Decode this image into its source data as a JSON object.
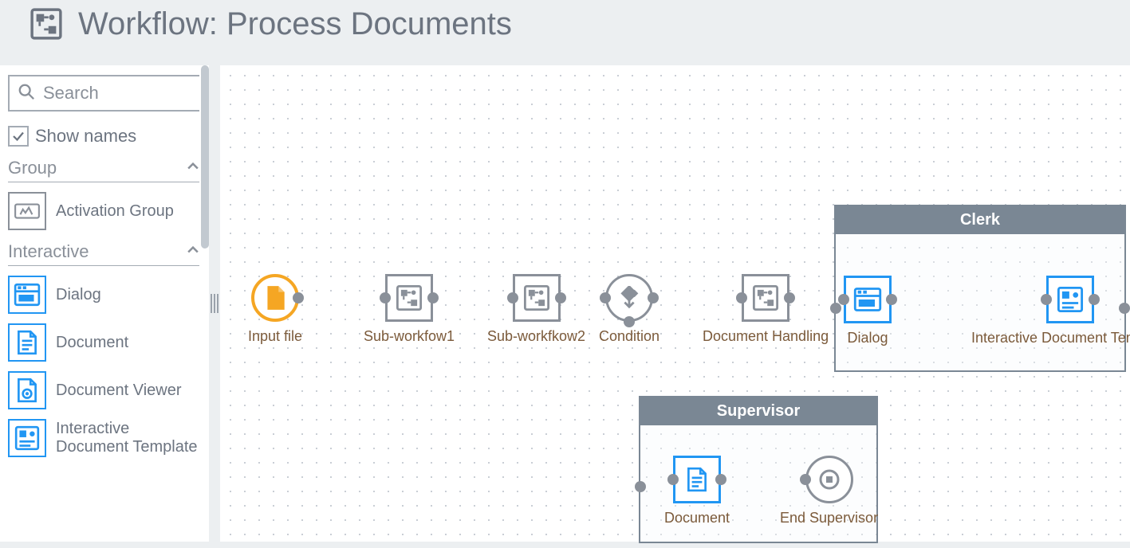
{
  "header": {
    "title": "Workflow: Process Documents"
  },
  "sidebar": {
    "search_placeholder": "Search",
    "show_names_label": "Show names",
    "show_names_checked": true,
    "sections": {
      "group": {
        "title": "Group",
        "items": [
          {
            "label": "Activation Group",
            "icon": "activation-group-icon",
            "color": "gray"
          }
        ]
      },
      "interactive": {
        "title": "Interactive",
        "items": [
          {
            "label": "Dialog",
            "icon": "dialog-icon",
            "color": "blue"
          },
          {
            "label": "Document",
            "icon": "document-icon",
            "color": "blue"
          },
          {
            "label": "Document Viewer",
            "icon": "document-viewer-icon",
            "color": "blue"
          },
          {
            "label": "Interactive Document Template",
            "icon": "document-template-icon",
            "color": "blue"
          }
        ]
      }
    }
  },
  "canvas": {
    "nodes": {
      "input": {
        "label": "Input file"
      },
      "sub1": {
        "label": "Sub-workfow1"
      },
      "sub2": {
        "label": "Sub-workfkow2"
      },
      "condition": {
        "label": "Condition"
      },
      "handling": {
        "label": "Document Handling"
      },
      "dialog": {
        "label": "Dialog"
      },
      "template": {
        "label": "Interactive Document Template"
      },
      "document": {
        "label": "Document"
      },
      "end": {
        "label": "End Supervisor"
      }
    },
    "groups": {
      "supervisor": {
        "title": "Supervisor"
      },
      "clerk": {
        "title": "Clerk"
      }
    }
  }
}
